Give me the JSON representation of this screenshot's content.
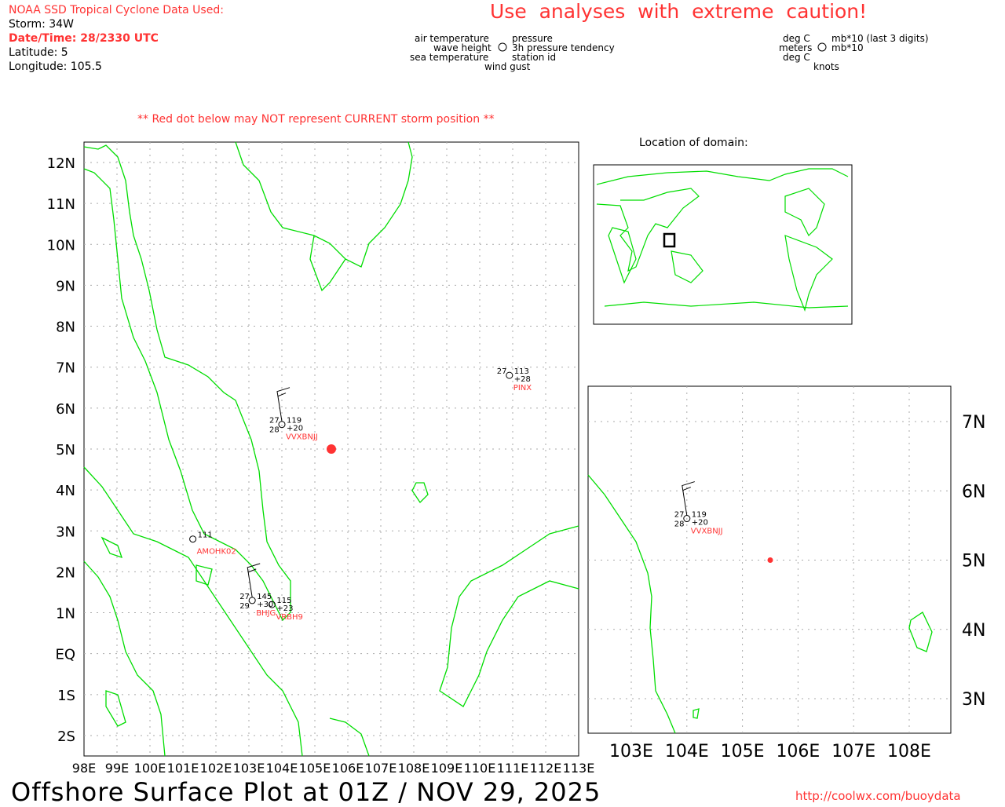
{
  "header": {
    "source": "NOAA SSD Tropical Cyclone Data Used:",
    "storm": "Storm: 34W",
    "datetime": "Date/Time: 28/2330 UTC",
    "latitude": "Latitude: 5",
    "longitude": "Longitude: 105.5",
    "warning": "Use  analyses  with  extreme  caution!",
    "red_dot_note": "** Red dot below may NOT represent CURRENT storm position **"
  },
  "legend": {
    "air_temp": "air temperature",
    "wave": "wave height",
    "sea_temp": "sea temperature",
    "pressure": "pressure",
    "tendency": "3h pressure tendency",
    "station": "station id",
    "gust": "wind gust",
    "u1": "deg C",
    "u2": "meters",
    "u3": "deg C",
    "u4": "mb*10 (last 3 digits)",
    "u5": "mb*10",
    "u6": "knots"
  },
  "main_map": {
    "lon_labels": [
      "98E",
      "99E",
      "100E",
      "101E",
      "102E",
      "103E",
      "104E",
      "105E",
      "106E",
      "107E",
      "108E",
      "109E",
      "110E",
      "111E",
      "112E",
      "113E"
    ],
    "lat_labels": [
      "12N",
      "11N",
      "10N",
      "9N",
      "8N",
      "7N",
      "6N",
      "5N",
      "4N",
      "3N",
      "2N",
      "1N",
      "EQ",
      "1S",
      "2S"
    ]
  },
  "storm": {
    "lat": 5,
    "lon": 105.5,
    "color": "#ff3333"
  },
  "stations": [
    {
      "id": "VVXBNJJ",
      "lat": 5.6,
      "lon": 104.0,
      "temp": "27",
      "sst": "28",
      "pres": "119",
      "tend": "+20"
    },
    {
      "id": "PINX",
      "lat": 6.8,
      "lon": 110.9,
      "temp": "27",
      "sst": "",
      "pres": "113",
      "tend": "+28"
    },
    {
      "id": "AMOHK02",
      "lat": 2.8,
      "lon": 101.3,
      "temp": "",
      "sst": "",
      "pres": "111",
      "tend": ""
    },
    {
      "id": "BHJG",
      "lat": 1.3,
      "lon": 103.1,
      "temp": "27",
      "sst": "29",
      "pres": "145",
      "tend": "+30"
    },
    {
      "id": "VRBH9",
      "lat": 1.2,
      "lon": 103.7,
      "temp": "",
      "sst": "",
      "pres": "115",
      "tend": "+23"
    }
  ],
  "locator": {
    "title": "Location of domain:"
  },
  "zoom_map": {
    "lon_labels": [
      "103E",
      "104E",
      "105E",
      "106E",
      "107E",
      "108E"
    ],
    "lat_labels": [
      "7N",
      "6N",
      "5N",
      "4N",
      "3N"
    ]
  },
  "footer": {
    "title": "Offshore Surface Plot at 01Z / NOV 29, 2025",
    "url": "http://coolwx.com/buoydata"
  }
}
